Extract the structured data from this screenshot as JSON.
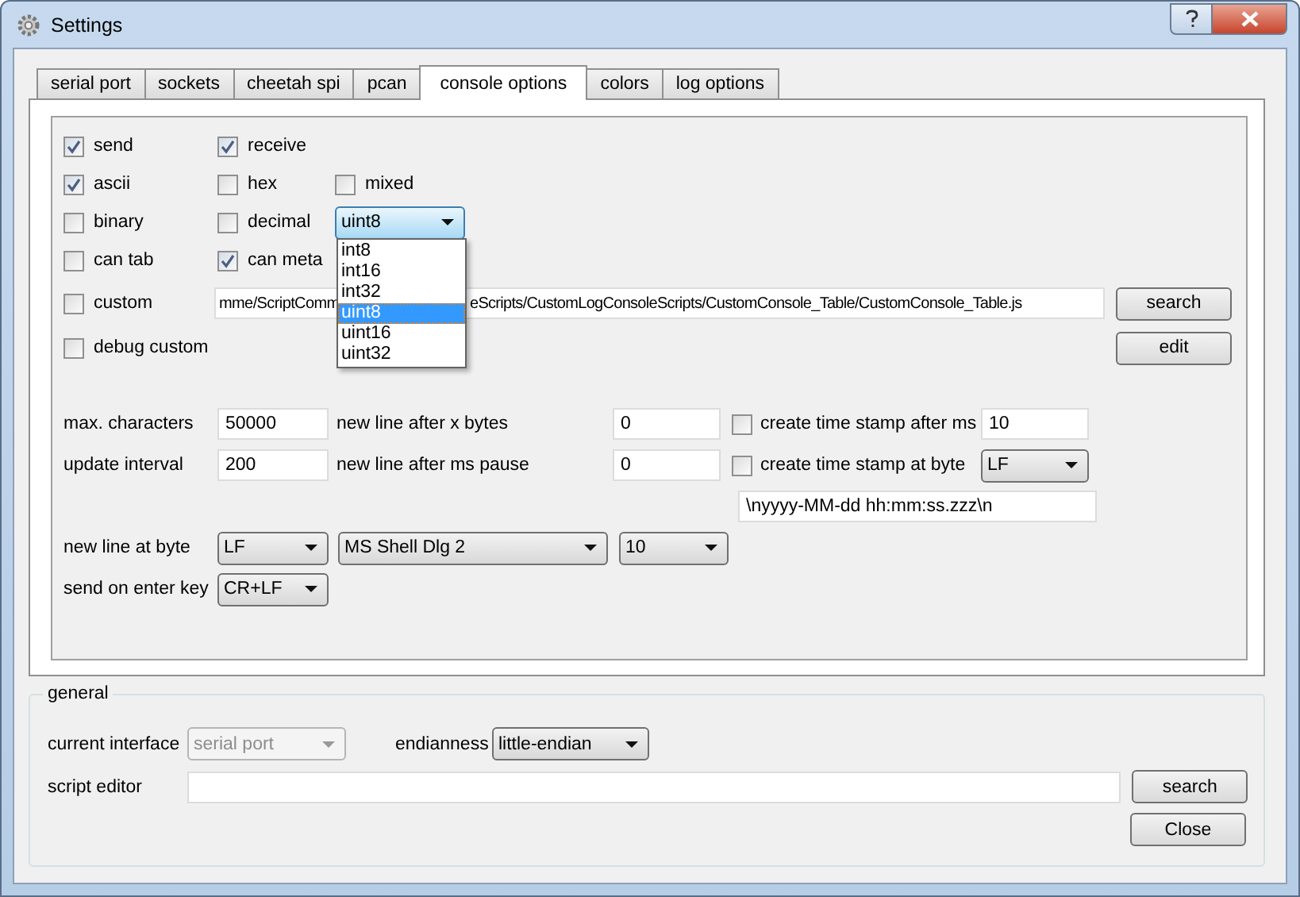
{
  "window": {
    "title": "Settings"
  },
  "tabs": [
    {
      "label": "serial port",
      "selected": false
    },
    {
      "label": "sockets",
      "selected": false
    },
    {
      "label": "cheetah spi",
      "selected": false
    },
    {
      "label": "pcan",
      "selected": false
    },
    {
      "label": "console options",
      "selected": true
    },
    {
      "label": "colors",
      "selected": false
    },
    {
      "label": "log options",
      "selected": false
    }
  ],
  "console_options": {
    "checkbox_rows": [
      {
        "items": [
          {
            "label": "send",
            "checked": true
          },
          {
            "label": "receive",
            "checked": true
          }
        ]
      },
      {
        "items": [
          {
            "label": "ascii",
            "checked": true
          },
          {
            "label": "hex",
            "checked": false
          },
          {
            "label": "mixed",
            "checked": false
          }
        ]
      },
      {
        "items": [
          {
            "label": "binary",
            "checked": false
          },
          {
            "label": "decimal",
            "checked": false
          }
        ],
        "type_dropdown": {
          "value": "uint8",
          "expanded": true,
          "options": [
            {
              "label": "int8",
              "selected": false
            },
            {
              "label": "int16",
              "selected": false
            },
            {
              "label": "int32",
              "selected": false
            },
            {
              "label": "uint8",
              "selected": true
            },
            {
              "label": "uint16",
              "selected": false
            },
            {
              "label": "uint32",
              "selected": false
            }
          ]
        }
      },
      {
        "items": [
          {
            "label": "can tab",
            "checked": false
          },
          {
            "label": "can meta",
            "checked": true
          }
        ]
      },
      {
        "items": [
          {
            "label": "custom",
            "checked": false
          }
        ],
        "script_path": {
          "visible_start": "mme/ScriptComm",
          "visible_end": "eScripts/CustomLogConsoleScripts/CustomConsole_Table/CustomConsole_Table.js"
        },
        "button": "search"
      },
      {
        "items": [
          {
            "label": "debug custom",
            "checked": false
          }
        ],
        "button": "edit"
      }
    ],
    "numeric_rows": [
      {
        "label": "max. characters",
        "value": "50000",
        "label_2": "new line after x bytes",
        "value_2": "0",
        "timestamp": {
          "kind": "field",
          "label": "create time stamp after ms",
          "checked": false,
          "value": "10"
        }
      },
      {
        "label": "update interval",
        "value": "200",
        "label_2": "new line after ms pause",
        "value_2": "0",
        "timestamp": {
          "kind": "dropdown",
          "label": "create time stamp at byte",
          "checked": false,
          "value": "LF"
        }
      }
    ],
    "timestamp_format": "\\nyyyy-MM-dd hh:mm:ss.zzz\\n",
    "new_line_at_byte": {
      "label": "new line at byte",
      "value": "LF",
      "font": "MS Shell Dlg 2",
      "font_size": "10"
    },
    "send_on_enter_key": {
      "label": "send on enter key",
      "value": "CR+LF"
    }
  },
  "general": {
    "title": "general",
    "current_interface": {
      "label": "current interface",
      "value": "serial port",
      "disabled": true
    },
    "endianness": {
      "label": "endianness",
      "value": "little-endian"
    },
    "script_editor": {
      "label": "script editor",
      "button": "search"
    },
    "close_button": "Close"
  }
}
